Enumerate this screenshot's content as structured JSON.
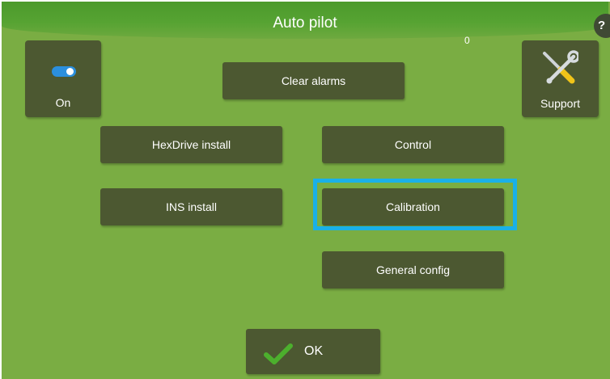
{
  "title": "Auto pilot",
  "help_label": "?",
  "counter": "0",
  "toggle": {
    "label": "On",
    "state": "on",
    "color": "#2b8fdd"
  },
  "support": {
    "label": "Support",
    "icon": "tools-icon"
  },
  "buttons": {
    "clear_alarms": "Clear alarms",
    "hexdrive_install": "HexDrive install",
    "control": "Control",
    "ins_install": "INS install",
    "calibration": "Calibration",
    "general_config": "General config",
    "ok": "OK"
  },
  "selected": "calibration",
  "colors": {
    "background": "#7aad43",
    "title_bar": "#4c9a2c",
    "button": "#4c5831",
    "highlight": "#1ab0e8",
    "check": "#4caf2d"
  }
}
